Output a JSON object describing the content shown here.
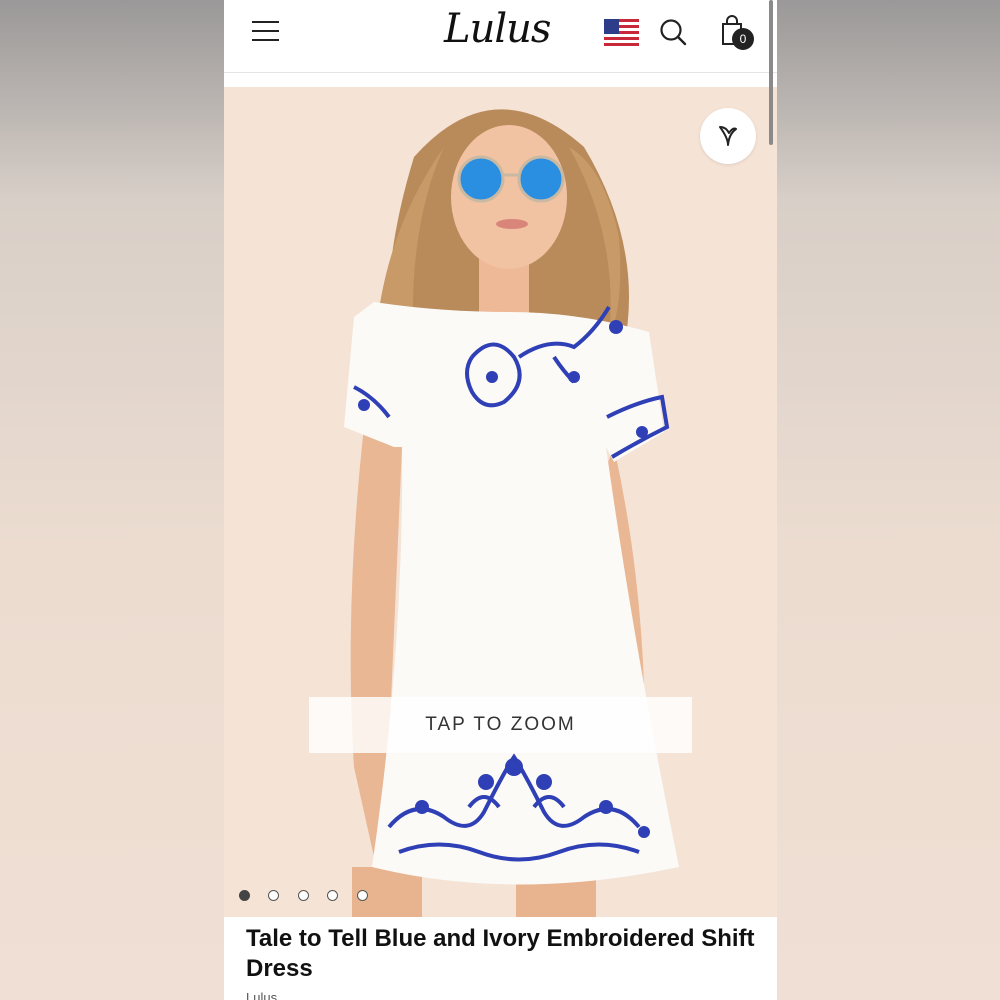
{
  "header": {
    "logo_text": "Lulus",
    "cart_count": "0",
    "icons": [
      "menu-icon",
      "us-flag-icon",
      "search-icon",
      "shopping-bag-icon"
    ]
  },
  "product": {
    "zoom_label": "TAP TO ZOOM",
    "carousel_count": 5,
    "carousel_active_index": 0,
    "title": "Tale to Tell Blue and Ivory Embroidered Shift Dress",
    "brand_partial": "Lulus"
  },
  "colors": {
    "backdrop": "#f5e3d6",
    "embroidery": "#2f3fb5",
    "dress": "#fbfaf7"
  }
}
